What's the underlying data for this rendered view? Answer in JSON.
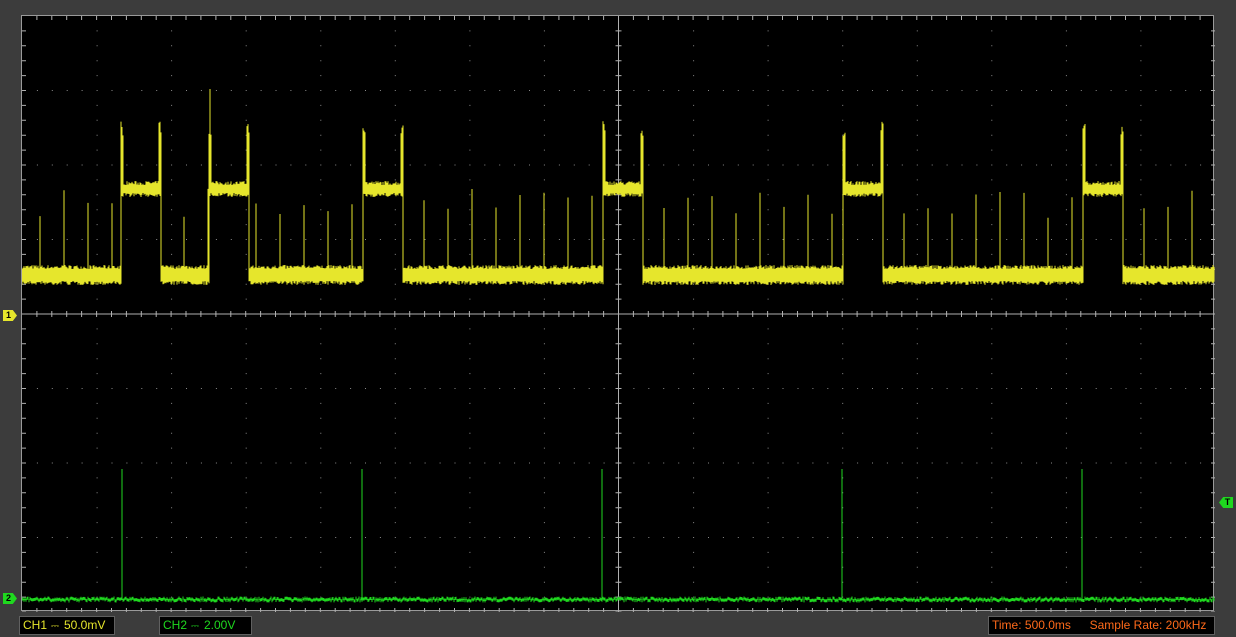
{
  "channels": [
    {
      "id": "ch1",
      "marker_label": "1",
      "status_label": "CH1",
      "coupling_icon": "dc-coupling-icon",
      "coupling_glyph": "⎓",
      "volts_div": "50.0mV",
      "color": "#e6e62c"
    },
    {
      "id": "ch2",
      "marker_label": "2",
      "status_label": "CH2",
      "coupling_icon": "dc-coupling-icon",
      "coupling_glyph": "⎓",
      "volts_div": "2.00V",
      "color": "#1fd81f"
    }
  ],
  "trigger": {
    "marker_label": "T",
    "color": "#1fd81f"
  },
  "status": {
    "time_label": "Time:",
    "time_value": "500.0ms",
    "sample_rate_label": "Sample Rate:",
    "sample_rate_value": "200kHz",
    "info_color": "#ff6a1a"
  },
  "colors": {
    "background": "#3c3c3c",
    "screen": "#000000",
    "grid": "#8a8a8a"
  }
}
